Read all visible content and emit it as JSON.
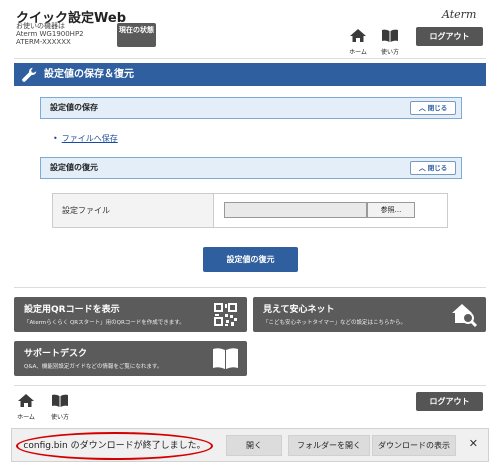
{
  "header": {
    "app_title": "クイック設定Web",
    "device_label": "お使いの機器は",
    "device_model": "Aterm WG1900HP2",
    "device_id": "ATERM-XXXXXX",
    "status_button": "現在の状態",
    "brand": "Aterm",
    "home_label": "ホーム",
    "help_label": "使い方",
    "logout": "ログアウト"
  },
  "page": {
    "title": "設定値の保存＆復元"
  },
  "save_panel": {
    "title": "設定値の保存",
    "close": "閉じる",
    "link": "ファイルへ保存"
  },
  "restore_panel": {
    "title": "設定値の復元",
    "close": "閉じる",
    "file_label": "設定ファイル",
    "file_value": "",
    "browse": "参照...",
    "submit": "設定値の復元"
  },
  "tiles": {
    "qr_title": "設定用QRコードを表示",
    "qr_desc": "「Atermらくらく QRスタート」用のQRコードを作成できます。",
    "safety_title": "見えて安心ネット",
    "safety_desc": "「こども安心ネットタイマー」などの設定はこちらから。",
    "support_title": "サポートデスク",
    "support_desc": "Q&A、機能別設定ガイドなどの情報をご覧になれます。"
  },
  "footer": {
    "home_label": "ホーム",
    "help_label": "使い方",
    "logout": "ログアウト"
  },
  "download_bar": {
    "message": "config.bin のダウンロードが終了しました。",
    "open": "開く",
    "open_folder": "フォルダーを開く",
    "show_downloads": "ダウンロードの表示",
    "close": "✕"
  },
  "colors": {
    "accent_blue": "#2f5f9e",
    "tile_gray": "#5b5b5b",
    "highlight_red": "#d40000"
  }
}
